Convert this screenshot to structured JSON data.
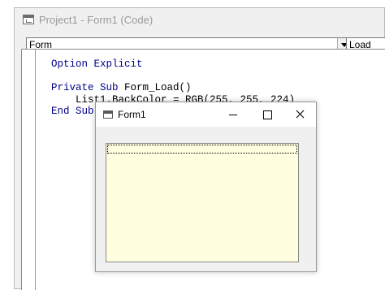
{
  "code_window": {
    "title": "Project1 - Form1 (Code)",
    "object_combo": {
      "value": "Form"
    },
    "procedure_combo": {
      "value": "Load"
    },
    "code_lines": [
      [
        "Option Explicit",
        ""
      ],
      [
        "",
        ""
      ],
      [
        "Private Sub",
        " Form_Load()"
      ],
      [
        "",
        "    List1.BackColor = RGB(255, 255, 224)"
      ],
      [
        "End Sub",
        ""
      ]
    ]
  },
  "form_window": {
    "title": "Form1",
    "listbox": {
      "backcolor": "#ffffe0"
    }
  },
  "colors": {
    "keyword": "#00008b",
    "listbox_background": "#ffffe0"
  }
}
